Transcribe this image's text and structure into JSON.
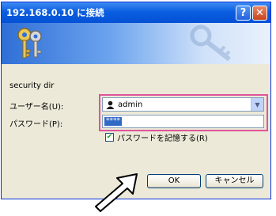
{
  "window": {
    "title": "192.168.0.10 に接続",
    "help_label": "?",
    "close_label": "✕"
  },
  "banner": {
    "icon": "keys-icon"
  },
  "realm": "security dir",
  "username": {
    "label": "ユーザー名(U):",
    "value": "admin"
  },
  "password": {
    "label": "パスワード(P):",
    "masked_value": "****"
  },
  "remember": {
    "label": "パスワードを記憶する(R)",
    "checked": true
  },
  "buttons": {
    "ok": "OK",
    "cancel": "キャンセル"
  },
  "colors": {
    "highlight_border": "#e0549a",
    "titlebar": "#0a5ee0"
  }
}
